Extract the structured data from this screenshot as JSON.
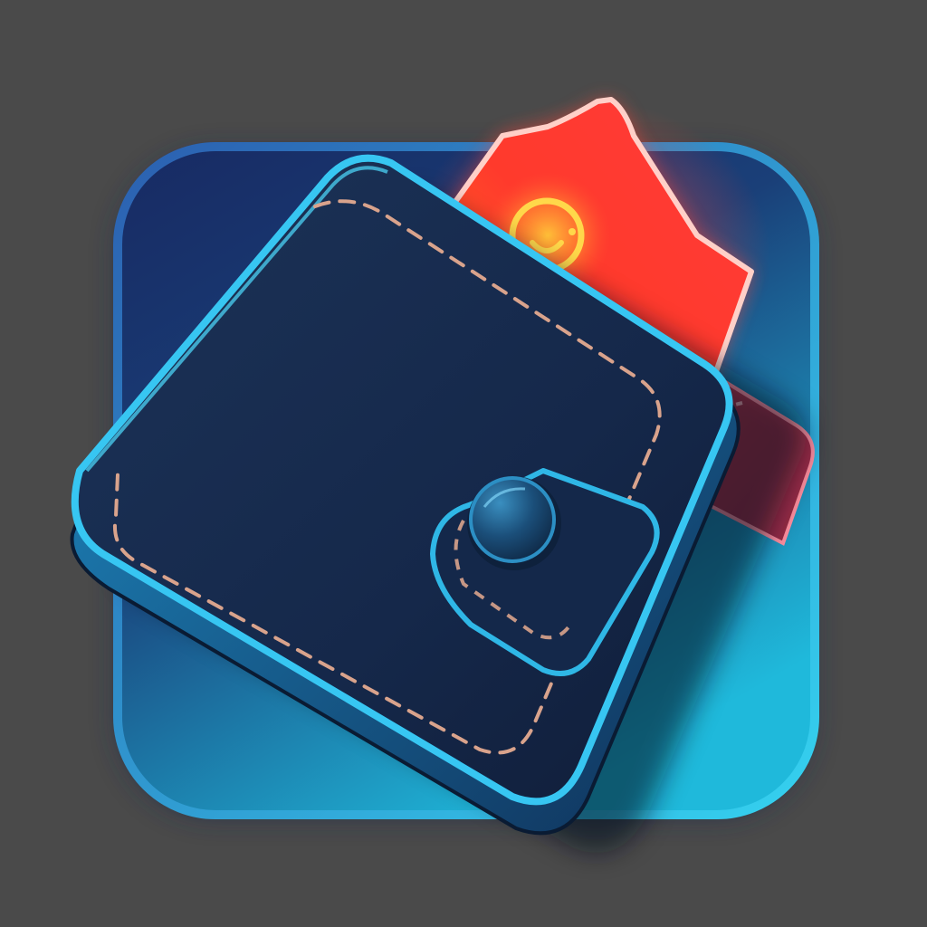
{
  "icon": {
    "subject": "wallet-icon",
    "background_color": "#4a4a4a",
    "tile_gradient": [
      "#14234f",
      "#1b4f86",
      "#1fb6d8"
    ],
    "wallet_color": "#17294a",
    "wallet_edge_color": "#2fb7e6",
    "stitch_color": "#d9a38c",
    "bill_colors": [
      "#ff3b2f",
      "#ff6a2a"
    ],
    "coin_symbol_color": "#ffd23a",
    "card_color": "#c23a4a",
    "clasp_color": "#1d5c86"
  }
}
